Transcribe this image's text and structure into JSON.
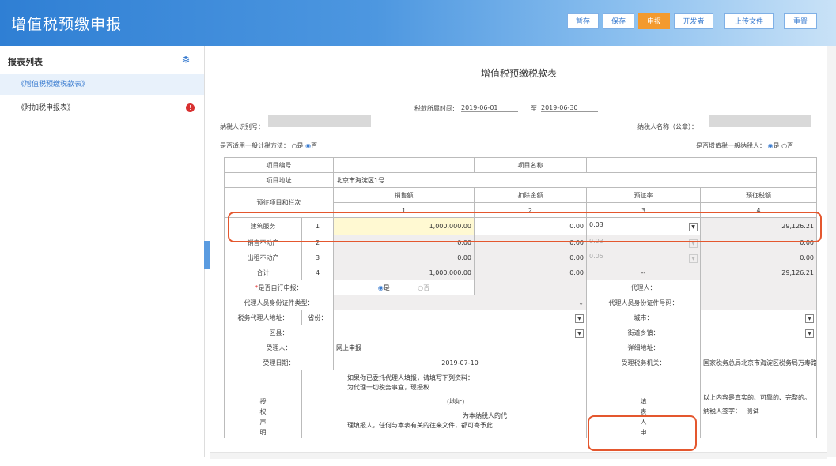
{
  "app": {
    "title": "增值税预缴申报"
  },
  "toolbar": {
    "save_temp": "暂存",
    "save": "保存",
    "submit": "申报",
    "developer": "开发者",
    "upload": "上传文件",
    "reset": "重置"
  },
  "sidebar": {
    "title": "报表列表",
    "items": [
      {
        "label": "《增值税预缴税款表》"
      },
      {
        "label": "《附加税申报表》",
        "badge": "!"
      }
    ]
  },
  "form": {
    "title": "增值税预缴税款表",
    "period_label": "税款所属时间:",
    "period_start": "2019-06-01",
    "period_to": "至",
    "period_end": "2019-06-30",
    "taxpayer_id_label": "纳税人识别号：",
    "taxpayer_name_label": "纳税人名称（公章）：",
    "general_method_label": "是否适用一般计税方法：",
    "yes": "是",
    "no": "否",
    "general_taxpayer_label": "是否增值税一般纳税人：",
    "project_no_label": "项目编号",
    "project_name_label": "项目名称",
    "project_addr_label": "项目地址",
    "project_addr_value": "北京市海淀区1号",
    "prepay_item_label": "预征项目和栏次",
    "col_headers": [
      "销售额",
      "扣除金额",
      "预征率",
      "预征税额"
    ],
    "col_numbers": [
      "1",
      "2",
      "3",
      "4"
    ],
    "rows": [
      {
        "name": "建筑服务",
        "no": "1",
        "sales": "1,000,000.00",
        "deduct": "0.00",
        "rate": "0.03",
        "tax": "29,126.21"
      },
      {
        "name": "销售不动产",
        "no": "2",
        "sales": "0.00",
        "deduct": "0.00",
        "rate": "0.03",
        "tax": "0.00"
      },
      {
        "name": "出租不动产",
        "no": "3",
        "sales": "0.00",
        "deduct": "0.00",
        "rate": "0.05",
        "tax": "0.00"
      },
      {
        "name": "合计",
        "no": "4",
        "sales": "1,000,000.00",
        "deduct": "0.00",
        "rate": "--",
        "tax": "29,126.21"
      }
    ],
    "self_declare_label": "是否自行申报：",
    "self_yes": "是",
    "self_no": "否",
    "agent_label": "代理人：",
    "agent_id_type_label": "代理人员身份证件类型：",
    "agent_id_no_label": "代理人员身份证件号码：",
    "agent_addr_label": "税务代理人地址：",
    "province_label": "省份：",
    "city_label": "城市：",
    "district_label": "区县：",
    "street_label": "街道乡镇：",
    "handler_label": "受理人：",
    "handler_value": "网上申报",
    "detail_addr_label": "详细地址：",
    "accept_date_label": "受理日期：",
    "accept_date_value": "2019-07-10",
    "tax_office_label": "受理税务机关：",
    "tax_office_value": "国家税务总局北京市海淀区税务局万寿路税务所",
    "auth_label": "授权声明",
    "auth_text_1": "如果你已委托代理人填报，请填写下列资料：",
    "auth_text_2": "为代理一切税务事宜，现授权",
    "auth_text_3": "(地址)",
    "auth_text_4": "为本纳税人的代",
    "auth_text_5": "理填报人，任何与本表有关的往来文件，都可寄予此",
    "filler_label": "填表人申",
    "declaration_text": "以上内容是真实的、可靠的、完整的。",
    "signature_label": "纳税人签字：",
    "signature_value": "测试"
  }
}
